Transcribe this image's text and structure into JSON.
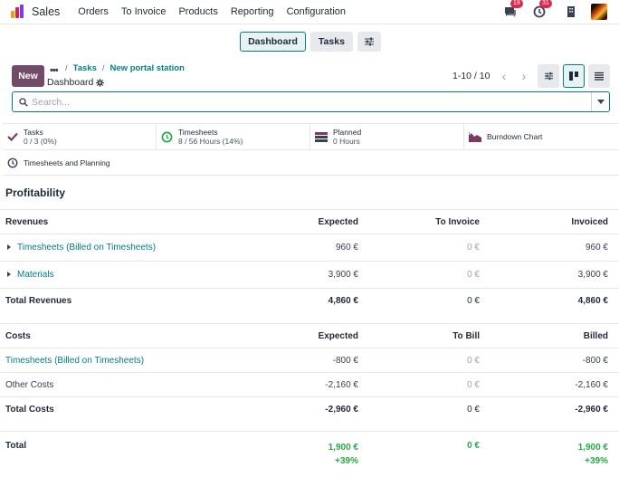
{
  "nav": {
    "app_name": "Sales",
    "menu": [
      "Orders",
      "To Invoice",
      "Products",
      "Reporting",
      "Configuration"
    ],
    "messages_badge": "19",
    "activities_badge": "31",
    "brand_color": "#714b67",
    "accent_color": "#017e84"
  },
  "control": {
    "dashboard_label": "Dashboard",
    "tasks_label": "Tasks",
    "new_label": "New",
    "breadcrumb": [
      "Tasks",
      "New portal station"
    ],
    "current_view": "Dashboard",
    "pager": "1-10 / 10",
    "search_placeholder": "Search..."
  },
  "stats": {
    "tasks": {
      "title": "Tasks",
      "value": "0 / 3 (0%)"
    },
    "timesheets": {
      "title": "Timesheets",
      "value": "8 / 56 Hours (14%)"
    },
    "planned": {
      "title": "Planned",
      "value": "0 Hours"
    },
    "burndown": {
      "title": "Burndown Chart"
    },
    "timesheets_planning": {
      "title": "Timesheets and Planning"
    }
  },
  "profitability": {
    "title": "Profitability",
    "revenues": {
      "headers": [
        "Revenues",
        "Expected",
        "To Invoice",
        "Invoiced"
      ],
      "rows": [
        {
          "label": "Timesheets (Billed on Timesheets)",
          "expected": "960 €",
          "to_invoice": "0 €",
          "invoiced": "960 €"
        },
        {
          "label": "Materials",
          "expected": "3,900 €",
          "to_invoice": "0 €",
          "invoiced": "3,900 €"
        }
      ],
      "total": {
        "label": "Total Revenues",
        "expected": "4,860 €",
        "to_invoice": "0 €",
        "invoiced": "4,860 €"
      }
    },
    "costs": {
      "headers": [
        "Costs",
        "Expected",
        "To Bill",
        "Billed"
      ],
      "rows": [
        {
          "label": "Timesheets (Billed on Timesheets)",
          "expected": "-800 €",
          "to_bill": "0 €",
          "billed": "-800 €"
        },
        {
          "label": "Other Costs",
          "expected": "-2,160 €",
          "to_bill": "0 €",
          "billed": "-2,160 €"
        }
      ],
      "total": {
        "label": "Total Costs",
        "expected": "-2,960 €",
        "to_bill": "0 €",
        "billed": "-2,960 €"
      }
    },
    "grand_total": {
      "label": "Total",
      "expected": "1,900 €",
      "expected_pct": "+39%",
      "to_bill": "0 €",
      "billed": "1,900 €",
      "billed_pct": "+39%"
    }
  }
}
